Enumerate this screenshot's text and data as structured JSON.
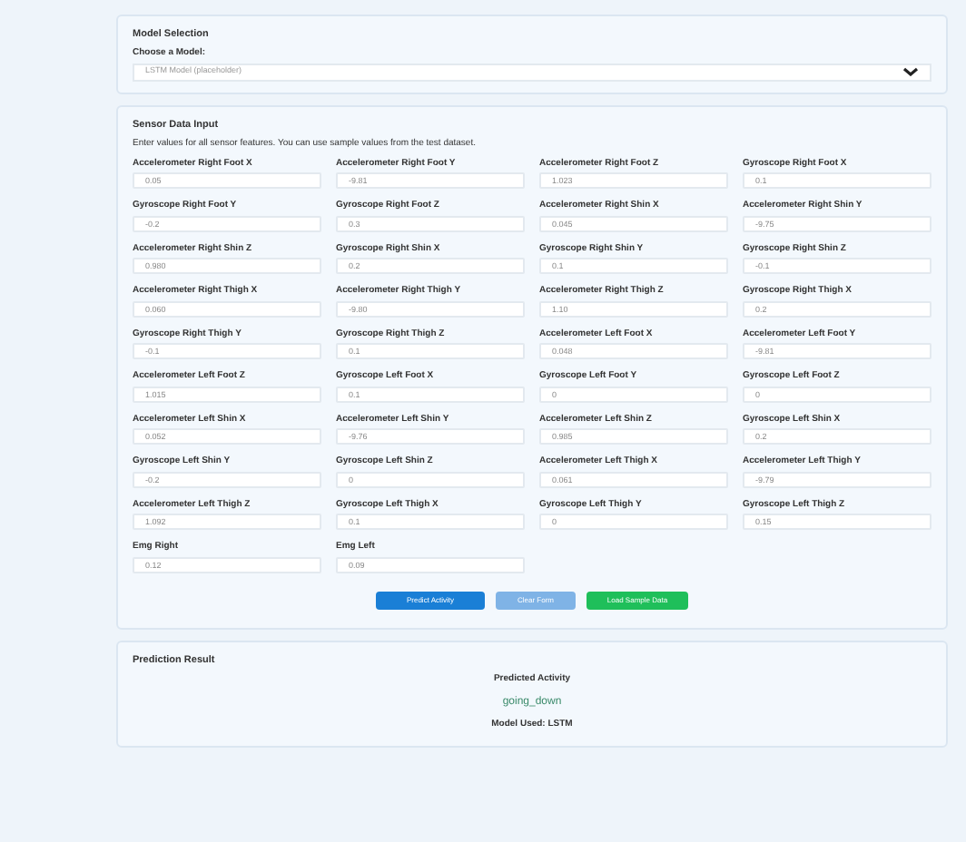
{
  "model_selection": {
    "title": "Model Selection",
    "label": "Choose a Model:",
    "value": "LSTM Model (placeholder)"
  },
  "sensor_input": {
    "title": "Sensor Data Input",
    "hint": "Enter values for all sensor features. You can use sample values from the test dataset.",
    "fields": [
      {
        "label": "Accelerometer Right Foot X",
        "value": "0.05"
      },
      {
        "label": "Accelerometer Right Foot Y",
        "value": "-9.81"
      },
      {
        "label": "Accelerometer Right Foot Z",
        "value": "1.023"
      },
      {
        "label": "Gyroscope Right Foot X",
        "value": "0.1"
      },
      {
        "label": "Gyroscope Right Foot Y",
        "value": "-0.2"
      },
      {
        "label": "Gyroscope Right Foot Z",
        "value": "0.3"
      },
      {
        "label": "Accelerometer Right Shin X",
        "value": "0.045"
      },
      {
        "label": "Accelerometer Right Shin Y",
        "value": "-9.75"
      },
      {
        "label": "Accelerometer Right Shin Z",
        "value": "0.980"
      },
      {
        "label": "Gyroscope Right Shin X",
        "value": "0.2"
      },
      {
        "label": "Gyroscope Right Shin Y",
        "value": "0.1"
      },
      {
        "label": "Gyroscope Right Shin Z",
        "value": "-0.1"
      },
      {
        "label": "Accelerometer Right Thigh X",
        "value": "0.060"
      },
      {
        "label": "Accelerometer Right Thigh Y",
        "value": "-9.80"
      },
      {
        "label": "Accelerometer Right Thigh Z",
        "value": "1.10"
      },
      {
        "label": "Gyroscope Right Thigh X",
        "value": "0.2"
      },
      {
        "label": "Gyroscope Right Thigh Y",
        "value": "-0.1"
      },
      {
        "label": "Gyroscope Right Thigh Z",
        "value": "0.1"
      },
      {
        "label": "Accelerometer Left Foot X",
        "value": "0.048"
      },
      {
        "label": "Accelerometer Left Foot Y",
        "value": "-9.81"
      },
      {
        "label": "Accelerometer Left Foot Z",
        "value": "1.015"
      },
      {
        "label": "Gyroscope Left Foot X",
        "value": "0.1"
      },
      {
        "label": "Gyroscope Left Foot Y",
        "value": "0"
      },
      {
        "label": "Gyroscope Left Foot Z",
        "value": "0"
      },
      {
        "label": "Accelerometer Left Shin X",
        "value": "0.052"
      },
      {
        "label": "Accelerometer Left Shin Y",
        "value": "-9.76"
      },
      {
        "label": "Accelerometer Left Shin Z",
        "value": "0.985"
      },
      {
        "label": "Gyroscope Left Shin X",
        "value": "0.2"
      },
      {
        "label": "Gyroscope Left Shin Y",
        "value": "-0.2"
      },
      {
        "label": "Gyroscope Left Shin Z",
        "value": "0"
      },
      {
        "label": "Accelerometer Left Thigh X",
        "value": "0.061"
      },
      {
        "label": "Accelerometer Left Thigh Y",
        "value": "-9.79"
      },
      {
        "label": "Accelerometer Left Thigh Z",
        "value": "1.092"
      },
      {
        "label": "Gyroscope Left Thigh X",
        "value": "0.1"
      },
      {
        "label": "Gyroscope Left Thigh Y",
        "value": "0"
      },
      {
        "label": "Gyroscope Left Thigh Z",
        "value": "0.15"
      }
    ],
    "emg": [
      {
        "label": "Emg Right",
        "value": "0.12"
      },
      {
        "label": "Emg Left",
        "value": "0.09"
      }
    ],
    "buttons": [
      {
        "kind": "primary",
        "label": "Predict Activity"
      },
      {
        "kind": "secondary",
        "label": "Clear Form"
      },
      {
        "kind": "success",
        "label": "Load Sample Data"
      }
    ]
  },
  "prediction": {
    "title": "Prediction Result",
    "heading": "Predicted Activity",
    "activity": "going_down",
    "model": "Model Used: LSTM"
  }
}
